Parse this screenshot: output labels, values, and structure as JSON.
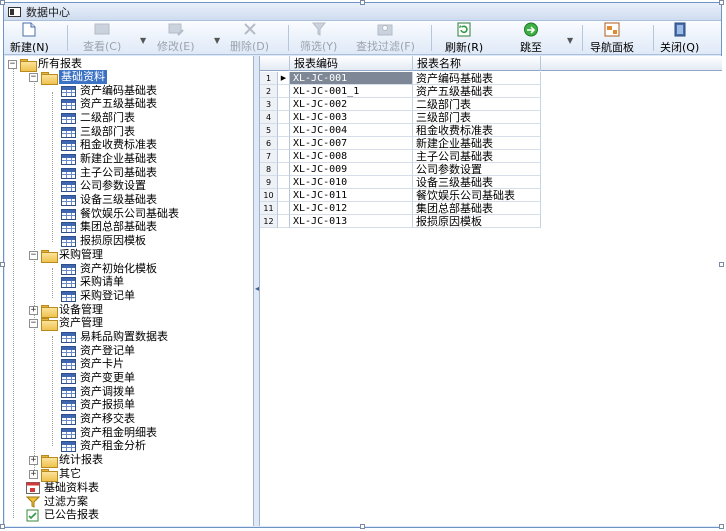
{
  "window": {
    "title": "数据中心"
  },
  "toolbar": {
    "buttons": [
      {
        "label": "新建(N)",
        "icon": "new-document-icon",
        "enabled": true
      },
      {
        "label": "查看(C)",
        "icon": "view-icon",
        "enabled": false
      },
      {
        "label": "修改(E)",
        "icon": "edit-icon",
        "enabled": false
      },
      {
        "label": "删除(D)",
        "icon": "delete-icon",
        "enabled": false
      },
      {
        "label": "筛选(Y)",
        "icon": "filter-icon",
        "enabled": false
      },
      {
        "label": "查找过滤(F)",
        "icon": "find-filter-icon",
        "enabled": false
      },
      {
        "label": "刷新(R)",
        "icon": "refresh-icon",
        "enabled": true
      },
      {
        "label": "跳至",
        "icon": "goto-icon",
        "enabled": true
      },
      {
        "label": "导航面板",
        "icon": "nav-panel-icon",
        "enabled": true
      },
      {
        "label": "关闭(Q)",
        "icon": "close-door-icon",
        "enabled": true
      }
    ]
  },
  "tree": {
    "root": "所有报表",
    "basic": {
      "label": "基础资料",
      "items": [
        "资产编码基础表",
        "资产五级基础表",
        "二级部门表",
        "三级部门表",
        "租金收费标准表",
        "新建企业基础表",
        "主子公司基础表",
        "公司参数设置",
        "设备三级基础表",
        "餐饮娱乐公司基础表",
        "集团总部基础表",
        "报损原因模板"
      ]
    },
    "purchase": {
      "label": "采购管理",
      "items": [
        "资产初始化模板",
        "采购请单",
        "采购登记单"
      ]
    },
    "equipment": {
      "label": "设备管理"
    },
    "asset": {
      "label": "资产管理",
      "items": [
        "易耗品购置数据表",
        "资产登记单",
        "资产卡片",
        "资产变更单",
        "资产调拨单",
        "资产报损单",
        "资产移交表",
        "资产租金明细表",
        "资产租金分析"
      ]
    },
    "stats": {
      "label": "统计报表"
    },
    "other": {
      "label": "其它"
    },
    "extra": [
      {
        "label": "基础资料表",
        "icon": "report-calendar-icon"
      },
      {
        "label": "过滤方案",
        "icon": "filter-scheme-icon"
      },
      {
        "label": "已公告报表",
        "icon": "published-report-icon"
      }
    ]
  },
  "grid": {
    "columns": [
      "报表编码",
      "报表名称"
    ],
    "rows": [
      {
        "num": "1",
        "code": "XL-JC-001",
        "name": "资产编码基础表"
      },
      {
        "num": "2",
        "code": "XL-JC-001_1",
        "name": "资产五级基础表"
      },
      {
        "num": "3",
        "code": "XL-JC-002",
        "name": "二级部门表"
      },
      {
        "num": "4",
        "code": "XL-JC-003",
        "name": "三级部门表"
      },
      {
        "num": "5",
        "code": "XL-JC-004",
        "name": "租金收费标准表"
      },
      {
        "num": "6",
        "code": "XL-JC-007",
        "name": "新建企业基础表"
      },
      {
        "num": "7",
        "code": "XL-JC-008",
        "name": "主子公司基础表"
      },
      {
        "num": "8",
        "code": "XL-JC-009",
        "name": "公司参数设置"
      },
      {
        "num": "9",
        "code": "XL-JC-010",
        "name": "设备三级基础表"
      },
      {
        "num": "10",
        "code": "XL-JC-011",
        "name": "餐饮娱乐公司基础表"
      },
      {
        "num": "11",
        "code": "XL-JC-012",
        "name": "集团总部基础表"
      },
      {
        "num": "12",
        "code": "XL-JC-013",
        "name": "报损原因模板"
      }
    ]
  }
}
